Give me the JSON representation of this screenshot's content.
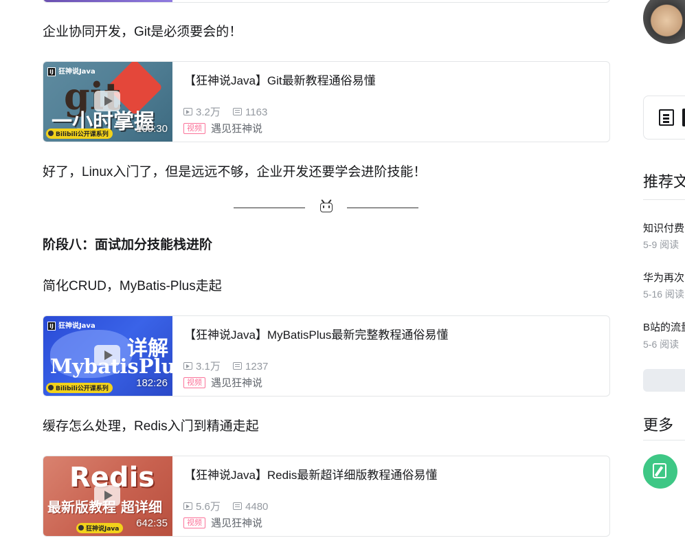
{
  "article": {
    "para_git": "企业协同开发，Git是必须要会的！",
    "para_linux": "好了，Linux入门了，但是远远不够，企业开发还要学会进阶技能！",
    "section8_title": "阶段八：面试加分技能栈进阶",
    "para_mybatis": "简化CRUD，MyBatis-Plus走起",
    "para_redis": "缓存怎么处理，Redis入门到精通走起",
    "cards": [
      {
        "thumb_brand": "狂神说Java",
        "thumb_text_1": "git",
        "thumb_text_2": "一小时掌握",
        "thumb_series": "Bilibili公开课系列",
        "duration": "109:30",
        "title": "【狂神说Java】Git最新教程通俗易懂",
        "views": "3.2万",
        "danmaku": "1163",
        "badge": "视频",
        "author": "遇见狂神说"
      },
      {
        "thumb_brand": "狂神说Java",
        "thumb_text_1": "详解",
        "thumb_text_2": "MybatisPlus",
        "thumb_series": "Bilibili公开课系列",
        "duration": "182:26",
        "title": "【狂神说Java】MyBatisPlus最新完整教程通俗易懂",
        "views": "3.1万",
        "danmaku": "1237",
        "badge": "视频",
        "author": "遇见狂神说"
      },
      {
        "thumb_text_1": "Redis",
        "thumb_text_2": "最新版教程 超详细",
        "thumb_series": "狂神说Java",
        "duration": "642:35",
        "title": "【狂神说Java】Redis最新超详细版教程通俗易懂",
        "views": "5.6万",
        "danmaku": "4480",
        "badge": "视频",
        "author": "遇见狂神说"
      }
    ]
  },
  "sidebar": {
    "recommend_title": "推荐文",
    "recommend_items": [
      {
        "title": "知识付费",
        "meta": "5-9 阅读"
      },
      {
        "title": "华为再次",
        "meta": "5-16 阅读"
      },
      {
        "title": "B站的流量",
        "meta": "5-6 阅读"
      }
    ],
    "more_title": "更多"
  }
}
